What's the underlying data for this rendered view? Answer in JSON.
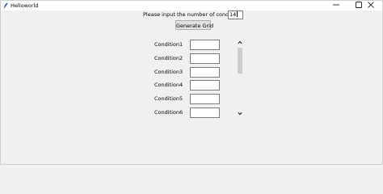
{
  "window": {
    "title": "Helloworld",
    "controls": {
      "minimize": "minimize-icon",
      "maximize": "maximize-icon",
      "close": "close-icon"
    }
  },
  "form": {
    "prompt_label": "Please input the number of condition",
    "count_value": "14",
    "generate_label": "Generate Grid"
  },
  "grid": {
    "conditions": [
      {
        "label": "Condition1",
        "value": ""
      },
      {
        "label": "Condition2",
        "value": ""
      },
      {
        "label": "Condition3",
        "value": ""
      },
      {
        "label": "Condition4",
        "value": ""
      },
      {
        "label": "Condition5",
        "value": ""
      },
      {
        "label": "Condition6",
        "value": ""
      }
    ],
    "scroll_position": 0
  },
  "colors": {
    "background": "#f0f0f0",
    "titlebar": "#ffffff",
    "button_face": "#e1e1e1",
    "scroll_thumb": "#cdcdcd"
  }
}
